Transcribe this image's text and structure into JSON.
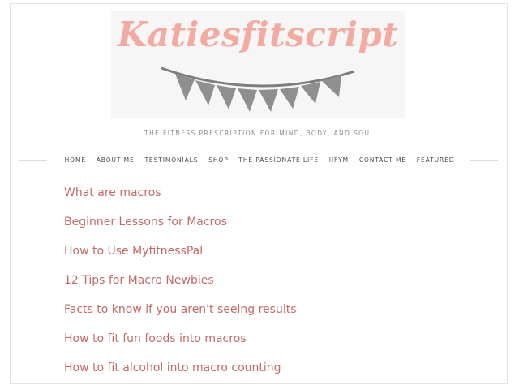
{
  "header": {
    "logo_text": "Katiesfitscript",
    "tagline": "THE FITNESS PRESCRIPTION FOR MIND, BODY, AND SOUL"
  },
  "nav": {
    "items": [
      {
        "label": "HOME"
      },
      {
        "label": "ABOUT ME"
      },
      {
        "label": "TESTIMONIALS"
      },
      {
        "label": "SHOP"
      },
      {
        "label": "THE PASSIONATE LIFE"
      },
      {
        "label": "IIFYM"
      },
      {
        "label": "CONTACT ME"
      },
      {
        "label": "FEATURED"
      }
    ]
  },
  "content": {
    "links": [
      {
        "label": "What are macros"
      },
      {
        "label": "Beginner Lessons for Macros"
      },
      {
        "label": "How to Use MyfitnessPal"
      },
      {
        "label": "12 Tips for Macro Newbies"
      },
      {
        "label": "Facts to know if you aren't seeing results"
      },
      {
        "label": "How to fit fun foods into macros"
      },
      {
        "label": "How to fit alcohol into macro counting"
      }
    ]
  },
  "colors": {
    "logo": "#f2aaa1",
    "bunting": "#8f8f8f",
    "link": "#c36b6b",
    "nav_text": "#4a4a4a",
    "tagline": "#8d8d8d"
  }
}
